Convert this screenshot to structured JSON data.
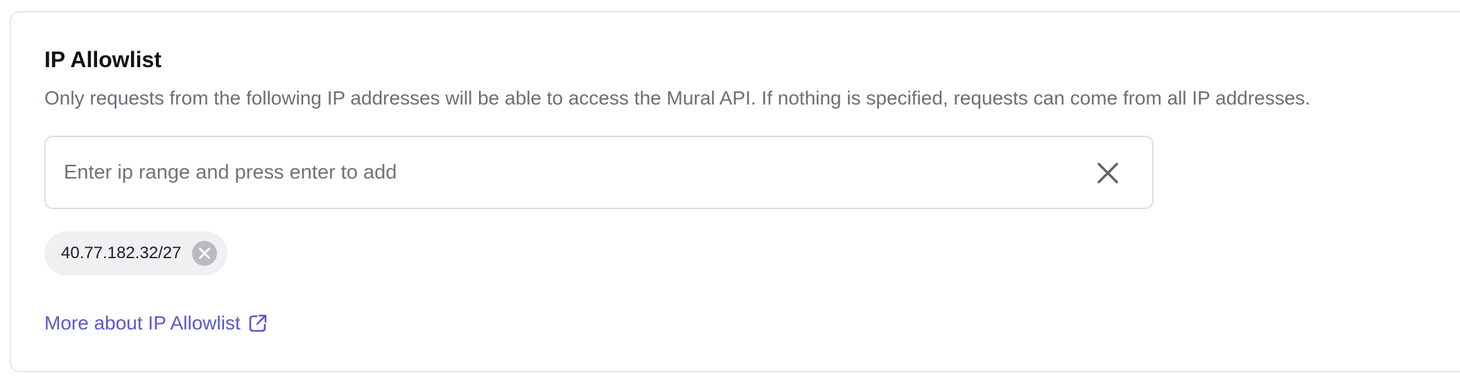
{
  "section": {
    "title": "IP Allowlist",
    "description": "Only requests from the following IP addresses will be able to access the Mural API. If nothing is specified, requests can come from all IP addresses."
  },
  "ip_input": {
    "value": "",
    "placeholder": "Enter ip range and press enter to add",
    "clear_icon": "close-icon"
  },
  "allowlist": [
    {
      "label": "40.77.182.32/27",
      "remove_icon": "remove-circle-icon"
    }
  ],
  "more_link": {
    "label": "More about IP Allowlist",
    "icon": "external-link-icon"
  },
  "colors": {
    "link": "#5b57d1",
    "chip_bg": "#f0f0f2",
    "border": "#dcdde1",
    "muted_text": "#6b6f77"
  }
}
